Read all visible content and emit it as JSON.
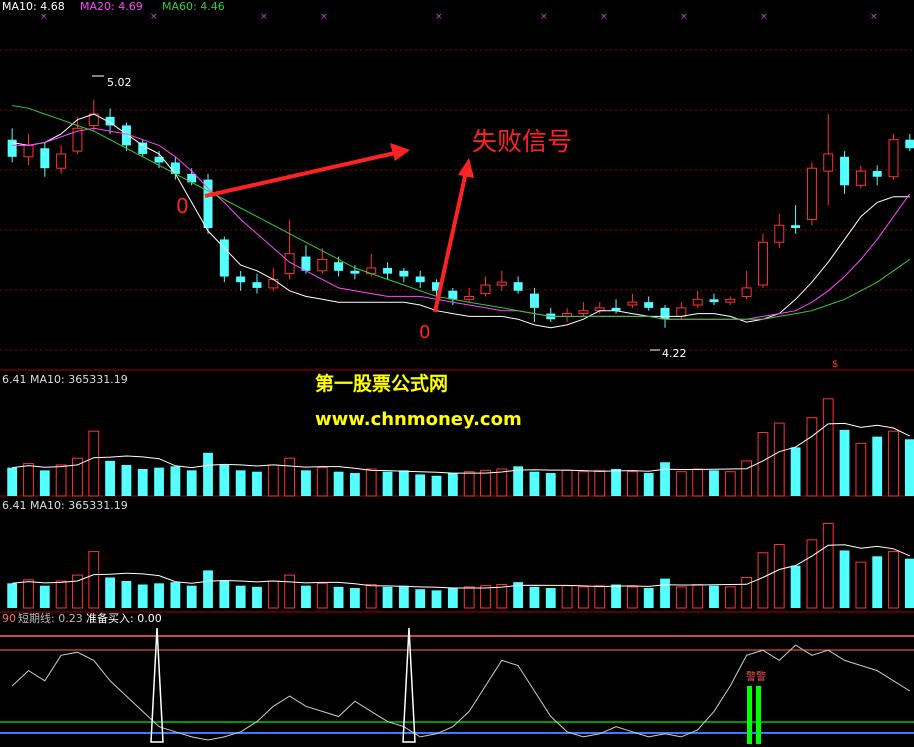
{
  "colors": {
    "background": "#000000",
    "up_candle": "#ff3333",
    "down_candle": "#54ffff",
    "ma_white": "#ffffff",
    "ma_magenta": "#ff44ff",
    "ma_green": "#33cc33",
    "panel_border": "#aa0000",
    "grid": "#8a0000",
    "watermark": "#ffff00",
    "annotation": "#ff2222",
    "signal_bar": "#00ff00",
    "band_red": "#ff6666",
    "band_green": "#00cc00",
    "band_blue": "#4477ff"
  },
  "header": {
    "ma10_label": "MA10: 4.68",
    "ma20_label": "MA20: 4.69",
    "ma60_label": "MA60: 4.46"
  },
  "price_annotations": {
    "high_label": "5.02",
    "low_label": "4.22"
  },
  "volume_panel_1": {
    "left_value": "6.41",
    "ma_label": "MA10: 365331.19"
  },
  "volume_panel_2": {
    "left_value": "6.41",
    "ma_label": "MA10: 365331.19"
  },
  "indicator_panel": {
    "left_value": "90",
    "short_line_label": "短期线: 0.23",
    "ready_buy_label": "准备买入: 0.00",
    "signal_glyph": "警警"
  },
  "watermark": {
    "line1": "第一股票公式网",
    "line2": "www.chnmoney.com"
  },
  "annotation": {
    "text": "失败信号",
    "marker": "0"
  },
  "chart_data": [
    {
      "type": "candlestick",
      "title": "",
      "xlabel": "",
      "ylabel": "",
      "ylim": [
        4.1,
        5.3
      ],
      "grid": true,
      "series": [
        {
          "name": "MA10",
          "values": [
            4.87,
            4.86,
            4.87,
            4.9,
            4.95,
            4.97,
            4.94,
            4.9,
            4.86,
            4.83,
            4.76,
            4.66,
            4.56,
            4.5,
            4.44,
            4.42,
            4.39,
            4.35,
            4.33,
            4.32,
            4.31,
            4.31,
            4.31,
            4.31,
            4.31,
            4.3,
            4.28,
            4.27,
            4.26,
            4.26,
            4.26,
            4.25,
            4.23,
            4.22,
            4.23,
            4.25,
            4.28,
            4.28,
            4.27,
            4.26,
            4.26,
            4.26,
            4.27,
            4.27,
            4.26,
            4.24,
            4.25,
            4.27,
            4.32,
            4.38,
            4.45,
            4.53,
            4.61,
            4.66,
            4.68,
            4.68
          ]
        },
        {
          "name": "MA20",
          "values": [
            4.86,
            4.86,
            4.87,
            4.89,
            4.91,
            4.92,
            4.91,
            4.9,
            4.88,
            4.86,
            4.82,
            4.77,
            4.71,
            4.66,
            4.6,
            4.55,
            4.5,
            4.45,
            4.42,
            4.39,
            4.36,
            4.35,
            4.34,
            4.33,
            4.33,
            4.33,
            4.32,
            4.31,
            4.3,
            4.29,
            4.28,
            4.28,
            4.27,
            4.26,
            4.26,
            4.26,
            4.26,
            4.26,
            4.26,
            4.26,
            4.25,
            4.25,
            4.25,
            4.25,
            4.25,
            4.25,
            4.26,
            4.27,
            4.28,
            4.31,
            4.35,
            4.4,
            4.46,
            4.53,
            4.61,
            4.69
          ]
        },
        {
          "name": "MA60",
          "values": [
            5.0,
            4.99,
            4.97,
            4.95,
            4.93,
            4.91,
            4.88,
            4.85,
            4.82,
            4.79,
            4.76,
            4.73,
            4.7,
            4.67,
            4.64,
            4.61,
            4.58,
            4.55,
            4.52,
            4.49,
            4.46,
            4.43,
            4.41,
            4.39,
            4.37,
            4.35,
            4.33,
            4.32,
            4.31,
            4.3,
            4.29,
            4.28,
            4.27,
            4.26,
            4.26,
            4.26,
            4.26,
            4.26,
            4.26,
            4.26,
            4.25,
            4.25,
            4.25,
            4.25,
            4.25,
            4.25,
            4.25,
            4.26,
            4.27,
            4.28,
            4.3,
            4.32,
            4.35,
            4.38,
            4.42,
            4.46
          ]
        }
      ],
      "candles": [
        {
          "o": 4.88,
          "c": 4.82,
          "h": 4.92,
          "l": 4.8
        },
        {
          "o": 4.82,
          "c": 4.86,
          "h": 4.9,
          "l": 4.79
        },
        {
          "o": 4.85,
          "c": 4.78,
          "h": 4.87,
          "l": 4.75
        },
        {
          "o": 4.78,
          "c": 4.83,
          "h": 4.86,
          "l": 4.76
        },
        {
          "o": 4.84,
          "c": 4.92,
          "h": 4.96,
          "l": 4.83
        },
        {
          "o": 4.93,
          "c": 4.97,
          "h": 5.02,
          "l": 4.91
        },
        {
          "o": 4.96,
          "c": 4.93,
          "h": 4.99,
          "l": 4.9
        },
        {
          "o": 4.93,
          "c": 4.86,
          "h": 4.94,
          "l": 4.84
        },
        {
          "o": 4.87,
          "c": 4.83,
          "h": 4.88,
          "l": 4.82
        },
        {
          "o": 4.82,
          "c": 4.8,
          "h": 4.84,
          "l": 4.78
        },
        {
          "o": 4.8,
          "c": 4.76,
          "h": 4.82,
          "l": 4.74
        },
        {
          "o": 4.76,
          "c": 4.73,
          "h": 4.78,
          "l": 4.72
        },
        {
          "o": 4.74,
          "c": 4.57,
          "h": 4.76,
          "l": 4.55
        },
        {
          "o": 4.53,
          "c": 4.4,
          "h": 4.54,
          "l": 4.38
        },
        {
          "o": 4.4,
          "c": 4.38,
          "h": 4.42,
          "l": 4.35
        },
        {
          "o": 4.38,
          "c": 4.36,
          "h": 4.41,
          "l": 4.34
        },
        {
          "o": 4.36,
          "c": 4.39,
          "h": 4.43,
          "l": 4.35
        },
        {
          "o": 4.41,
          "c": 4.48,
          "h": 4.6,
          "l": 4.39
        },
        {
          "o": 4.47,
          "c": 4.42,
          "h": 4.51,
          "l": 4.41
        },
        {
          "o": 4.42,
          "c": 4.46,
          "h": 4.5,
          "l": 4.41
        },
        {
          "o": 4.45,
          "c": 4.42,
          "h": 4.47,
          "l": 4.4
        },
        {
          "o": 4.42,
          "c": 4.41,
          "h": 4.44,
          "l": 4.39
        },
        {
          "o": 4.41,
          "c": 4.43,
          "h": 4.48,
          "l": 4.4
        },
        {
          "o": 4.43,
          "c": 4.41,
          "h": 4.45,
          "l": 4.39
        },
        {
          "o": 4.42,
          "c": 4.4,
          "h": 4.43,
          "l": 4.38
        },
        {
          "o": 4.4,
          "c": 4.38,
          "h": 4.42,
          "l": 4.36
        },
        {
          "o": 4.38,
          "c": 4.35,
          "h": 4.39,
          "l": 4.33
        },
        {
          "o": 4.35,
          "c": 4.32,
          "h": 4.36,
          "l": 4.3
        },
        {
          "o": 4.32,
          "c": 4.33,
          "h": 4.36,
          "l": 4.31
        },
        {
          "o": 4.34,
          "c": 4.37,
          "h": 4.4,
          "l": 4.33
        },
        {
          "o": 4.37,
          "c": 4.38,
          "h": 4.42,
          "l": 4.35
        },
        {
          "o": 4.38,
          "c": 4.35,
          "h": 4.4,
          "l": 4.34
        },
        {
          "o": 4.34,
          "c": 4.29,
          "h": 4.36,
          "l": 4.24
        },
        {
          "o": 4.27,
          "c": 4.25,
          "h": 4.29,
          "l": 4.24
        },
        {
          "o": 4.26,
          "c": 4.27,
          "h": 4.29,
          "l": 4.24
        },
        {
          "o": 4.27,
          "c": 4.28,
          "h": 4.31,
          "l": 4.26
        },
        {
          "o": 4.28,
          "c": 4.29,
          "h": 4.31,
          "l": 4.27
        },
        {
          "o": 4.29,
          "c": 4.28,
          "h": 4.32,
          "l": 4.27
        },
        {
          "o": 4.3,
          "c": 4.31,
          "h": 4.34,
          "l": 4.29
        },
        {
          "o": 4.31,
          "c": 4.29,
          "h": 4.33,
          "l": 4.28
        },
        {
          "o": 4.29,
          "c": 4.25,
          "h": 4.3,
          "l": 4.22
        },
        {
          "o": 4.26,
          "c": 4.29,
          "h": 4.31,
          "l": 4.25
        },
        {
          "o": 4.3,
          "c": 4.32,
          "h": 4.35,
          "l": 4.29
        },
        {
          "o": 4.32,
          "c": 4.31,
          "h": 4.34,
          "l": 4.3
        },
        {
          "o": 4.31,
          "c": 4.32,
          "h": 4.33,
          "l": 4.3
        },
        {
          "o": 4.33,
          "c": 4.36,
          "h": 4.42,
          "l": 4.32
        },
        {
          "o": 4.37,
          "c": 4.52,
          "h": 4.55,
          "l": 4.36
        },
        {
          "o": 4.52,
          "c": 4.58,
          "h": 4.62,
          "l": 4.5
        },
        {
          "o": 4.58,
          "c": 4.57,
          "h": 4.65,
          "l": 4.55
        },
        {
          "o": 4.6,
          "c": 4.78,
          "h": 4.8,
          "l": 4.58
        },
        {
          "o": 4.77,
          "c": 4.83,
          "h": 4.97,
          "l": 4.65
        },
        {
          "o": 4.82,
          "c": 4.72,
          "h": 4.84,
          "l": 4.69
        },
        {
          "o": 4.72,
          "c": 4.77,
          "h": 4.79,
          "l": 4.71
        },
        {
          "o": 4.77,
          "c": 4.75,
          "h": 4.79,
          "l": 4.72
        },
        {
          "o": 4.75,
          "c": 4.88,
          "h": 4.9,
          "l": 4.74
        },
        {
          "o": 4.88,
          "c": 4.85,
          "h": 4.9,
          "l": 4.84
        }
      ]
    },
    {
      "type": "bar",
      "title": "",
      "series": [
        {
          "name": "",
          "values": [
            21,
            24,
            19,
            23,
            28,
            48,
            26,
            23,
            20,
            21,
            22,
            19,
            32,
            23,
            19,
            18,
            23,
            28,
            19,
            21,
            18,
            17,
            20,
            18,
            19,
            16,
            15,
            17,
            18,
            19,
            20,
            22,
            18,
            17,
            19,
            18,
            19,
            20,
            18,
            17,
            25,
            18,
            20,
            19,
            18,
            26,
            47,
            54,
            36,
            58,
            72,
            49,
            39,
            44,
            48,
            42
          ]
        }
      ],
      "ylim": [
        0,
        80
      ]
    },
    {
      "type": "bar",
      "title": "",
      "series": [
        {
          "name": "",
          "values": [
            21,
            24,
            19,
            23,
            28,
            48,
            26,
            23,
            20,
            21,
            22,
            19,
            32,
            23,
            19,
            18,
            23,
            28,
            19,
            21,
            18,
            17,
            20,
            18,
            19,
            16,
            15,
            17,
            18,
            19,
            20,
            22,
            18,
            17,
            19,
            18,
            19,
            20,
            18,
            17,
            25,
            18,
            20,
            19,
            18,
            26,
            47,
            54,
            36,
            58,
            72,
            49,
            39,
            44,
            48,
            42
          ]
        }
      ],
      "ylim": [
        0,
        80
      ]
    },
    {
      "type": "line",
      "title": "",
      "series": [
        {
          "name": "短期线",
          "values": [
            0.55,
            0.7,
            0.6,
            0.85,
            0.88,
            0.8,
            0.6,
            0.45,
            0.3,
            0.15,
            0.1,
            0.05,
            0.02,
            0.05,
            0.1,
            0.2,
            0.35,
            0.45,
            0.35,
            0.3,
            0.25,
            0.4,
            0.3,
            0.2,
            0.15,
            0.05,
            0.08,
            0.15,
            0.3,
            0.55,
            0.8,
            0.75,
            0.5,
            0.25,
            0.1,
            0.05,
            0.08,
            0.15,
            0.1,
            0.05,
            0.08,
            0.05,
            0.12,
            0.3,
            0.55,
            0.85,
            0.9,
            0.8,
            0.95,
            0.85,
            0.9,
            0.8,
            0.75,
            0.7,
            0.6,
            0.5
          ]
        }
      ],
      "ylim": [
        0,
        1
      ]
    }
  ]
}
